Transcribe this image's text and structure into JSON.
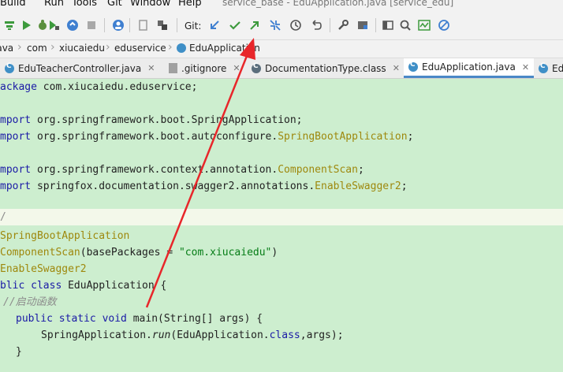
{
  "menu": {
    "items": [
      "Build",
      "Run",
      "Tools",
      "Git",
      "Window",
      "Help"
    ],
    "window_title": "service_base - EduApplication.java [service_edu]"
  },
  "toolbar": {
    "git_label": "Git:",
    "icons": [
      "build-icon",
      "run-config-icon",
      "debug-icon",
      "coverage-icon",
      "profile-icon",
      "stop-icon",
      "avatar-icon",
      "project-icon",
      "sync-icon",
      "git-update-icon",
      "git-commit-icon",
      "git-push-icon",
      "git-merge-icon",
      "history-icon",
      "rollback-icon",
      "settings-wrench-icon",
      "project-structure-icon",
      "run-terminal-icon",
      "search-icon",
      "monitor-icon",
      "no-icon"
    ]
  },
  "breadcrumb": {
    "items": [
      "java",
      "com",
      "xiucaiedu",
      "eduservice",
      "EduApplication"
    ]
  },
  "tabs": [
    {
      "label": "EduTeacherController.java",
      "active": false
    },
    {
      "label": ".gitignore",
      "active": false
    },
    {
      "label": "DocumentationType.class",
      "active": false
    },
    {
      "label": "EduApplication.java",
      "active": true
    },
    {
      "label": "Ed",
      "active": false
    }
  ],
  "code": {
    "l1_kw": "ackage",
    "l1_rest": " com.xiucaiedu.eduservice;",
    "l3_kw": "mport",
    "l3_rest": " org.springframework.boot.SpringApplication;",
    "l4_kw": "mport",
    "l4_rest": " org.springframework.boot.autoconfigure.",
    "l4_ann": "SpringBootApplication",
    "l4_end": ";",
    "l6_kw": "mport",
    "l6_rest": " org.springframework.context.annotation.",
    "l6_ann": "ComponentScan",
    "l6_end": ";",
    "l7_kw": "mport",
    "l7_rest": " springfox.documentation.swagger2.annotations.",
    "l7_ann": "EnableSwagger2",
    "l7_end": ";",
    "l9": "/",
    "l10_ann": "SpringBootApplication",
    "l11_ann": "ComponentScan",
    "l11_mid": "(basePackages = ",
    "l11_str": "\"com.xiucaiedu\"",
    "l11_end": ")",
    "l12_ann": "EnableSwagger2",
    "l13_kw": "blic class",
    "l13_rest": " EduApplication {",
    "l14_cm": "//启动函数",
    "l15_kw": "public static void",
    "l15_rest": " main(String[] args) {",
    "l16_a": "SpringApplication.",
    "l16_it": "run",
    "l16_b": "(EduApplication.",
    "l16_kw": "class",
    "l16_c": ",args);",
    "l17": "}"
  },
  "colors": {
    "editor_bg": "#cdeecf",
    "annotation": "#9e880d",
    "keyword": "#1a1aa6",
    "string": "#067d17",
    "arrow": "#e8262a",
    "tab_underline": "#4a88c7"
  }
}
